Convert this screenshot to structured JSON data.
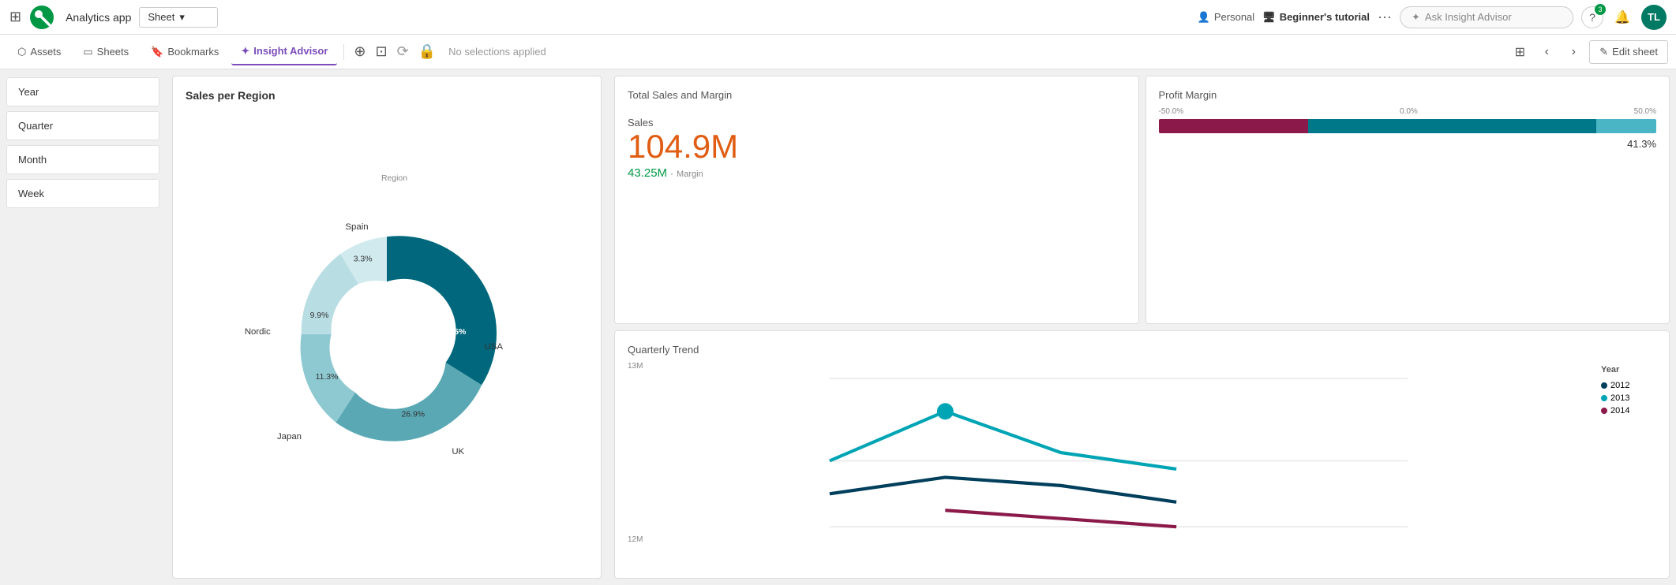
{
  "topbar": {
    "app_name": "Analytics app",
    "sheet_label": "Sheet",
    "personal_label": "Personal",
    "tutorial_label": "Beginner's tutorial",
    "insight_placeholder": "Ask Insight Advisor",
    "help_icon": "?",
    "badge_count": "3",
    "avatar_initials": "TL"
  },
  "subnav": {
    "assets_label": "Assets",
    "sheets_label": "Sheets",
    "bookmarks_label": "Bookmarks",
    "insight_advisor_label": "Insight Advisor",
    "no_selections_label": "No selections applied",
    "edit_sheet_label": "Edit sheet"
  },
  "sidebar": {
    "items": [
      {
        "label": "Year"
      },
      {
        "label": "Quarter"
      },
      {
        "label": "Month"
      },
      {
        "label": "Week"
      }
    ]
  },
  "sales_per_region": {
    "title": "Sales per Region",
    "legend_label": "Region",
    "segments": [
      {
        "label": "USA",
        "pct": 45.5,
        "color": "#00677c"
      },
      {
        "label": "UK",
        "pct": 26.9,
        "color": "#5ba8b5"
      },
      {
        "label": "Japan",
        "pct": 11.3,
        "color": "#8ec9d2"
      },
      {
        "label": "Nordic",
        "pct": 9.9,
        "color": "#b8dde3"
      },
      {
        "label": "Spain",
        "pct": 3.3,
        "color": "#d0eaee"
      }
    ]
  },
  "total_sales": {
    "title": "Total Sales and Margin",
    "sales_label": "Sales",
    "sales_value": "104.9M",
    "margin_value": "43.25M",
    "margin_label": "Margin"
  },
  "profit_margin": {
    "title": "Profit Margin",
    "scale_min": "-50.0%",
    "scale_mid": "0.0%",
    "scale_max": "50.0%",
    "value": "41.3%",
    "bar_neg_pct": 30,
    "bar_pos_pct": 58,
    "bar_small_pct": 12
  },
  "quarterly_trend": {
    "title": "Quarterly Trend",
    "y_max": "13M",
    "y_min": "12M",
    "legend_title": "Year",
    "legend_items": [
      {
        "year": "2012",
        "color": "#003f5c"
      },
      {
        "year": "2013",
        "color": "#00a5b5"
      },
      {
        "year": "2014",
        "color": "#8b1a4a"
      }
    ]
  }
}
